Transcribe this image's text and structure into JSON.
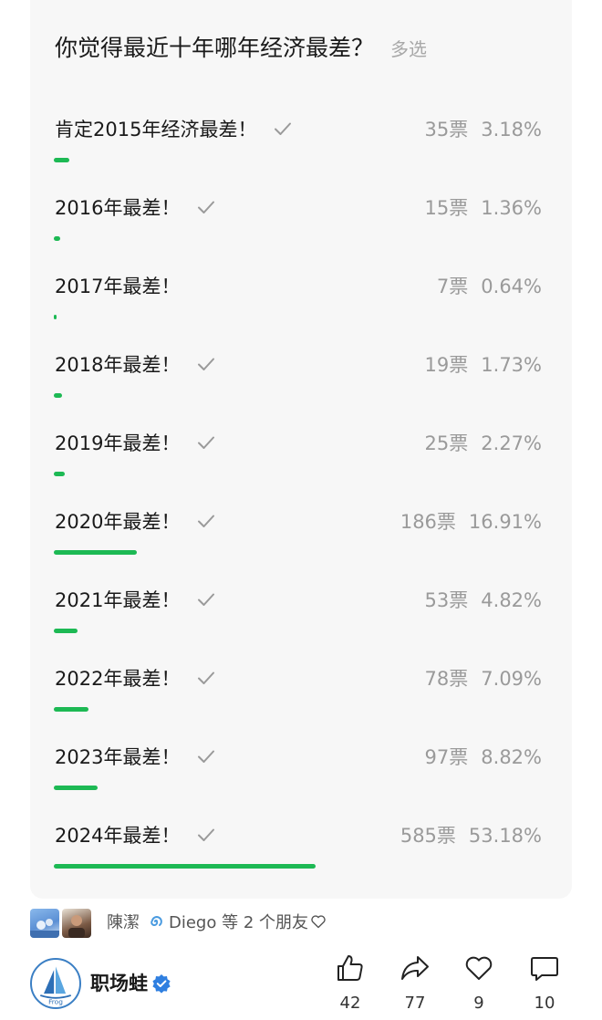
{
  "poll": {
    "question": "你觉得最近十年哪年经济最差？",
    "mode_label": "多选",
    "options": [
      {
        "label": "肯定2015年经济最差！",
        "votes": "35票",
        "percent": "3.18%",
        "fraction": 0.0318,
        "checked": true
      },
      {
        "label": "2016年最差！",
        "votes": "15票",
        "percent": "1.36%",
        "fraction": 0.0136,
        "checked": true
      },
      {
        "label": "2017年最差！",
        "votes": "7票",
        "percent": "0.64%",
        "fraction": 0.0064,
        "checked": false
      },
      {
        "label": "2018年最差！",
        "votes": "19票",
        "percent": "1.73%",
        "fraction": 0.0173,
        "checked": true
      },
      {
        "label": "2019年最差！",
        "votes": "25票",
        "percent": "2.27%",
        "fraction": 0.0227,
        "checked": true
      },
      {
        "label": "2020年最差！",
        "votes": "186票",
        "percent": "16.91%",
        "fraction": 0.1691,
        "checked": true
      },
      {
        "label": "2021年最差！",
        "votes": "53票",
        "percent": "4.82%",
        "fraction": 0.0482,
        "checked": true
      },
      {
        "label": "2022年最差！",
        "votes": "78票",
        "percent": "7.09%",
        "fraction": 0.0709,
        "checked": true
      },
      {
        "label": "2023年最差！",
        "votes": "97票",
        "percent": "8.82%",
        "fraction": 0.0882,
        "checked": true
      },
      {
        "label": "2024年最差！",
        "votes": "585票",
        "percent": "53.18%",
        "fraction": 0.5318,
        "checked": true
      }
    ]
  },
  "friends": {
    "name1": "陳潔",
    "name2": "Diego",
    "suffix": "等 2 个朋友"
  },
  "author": {
    "name": "职场蛙",
    "logo_text": "Frog"
  },
  "actions": {
    "like": "42",
    "share": "77",
    "favorite": "9",
    "comment": "10"
  },
  "colors": {
    "accent": "#1db954",
    "card_bg": "#f7f7f7",
    "muted_text": "#9a9a9a",
    "verified": "#2f7fe0"
  },
  "icons": [
    "check-icon",
    "spiral-emoji-icon",
    "heart-icon",
    "verified-badge-icon",
    "thumbs-up-icon",
    "share-arrow-icon",
    "heart-outline-icon",
    "comment-bubble-icon"
  ]
}
